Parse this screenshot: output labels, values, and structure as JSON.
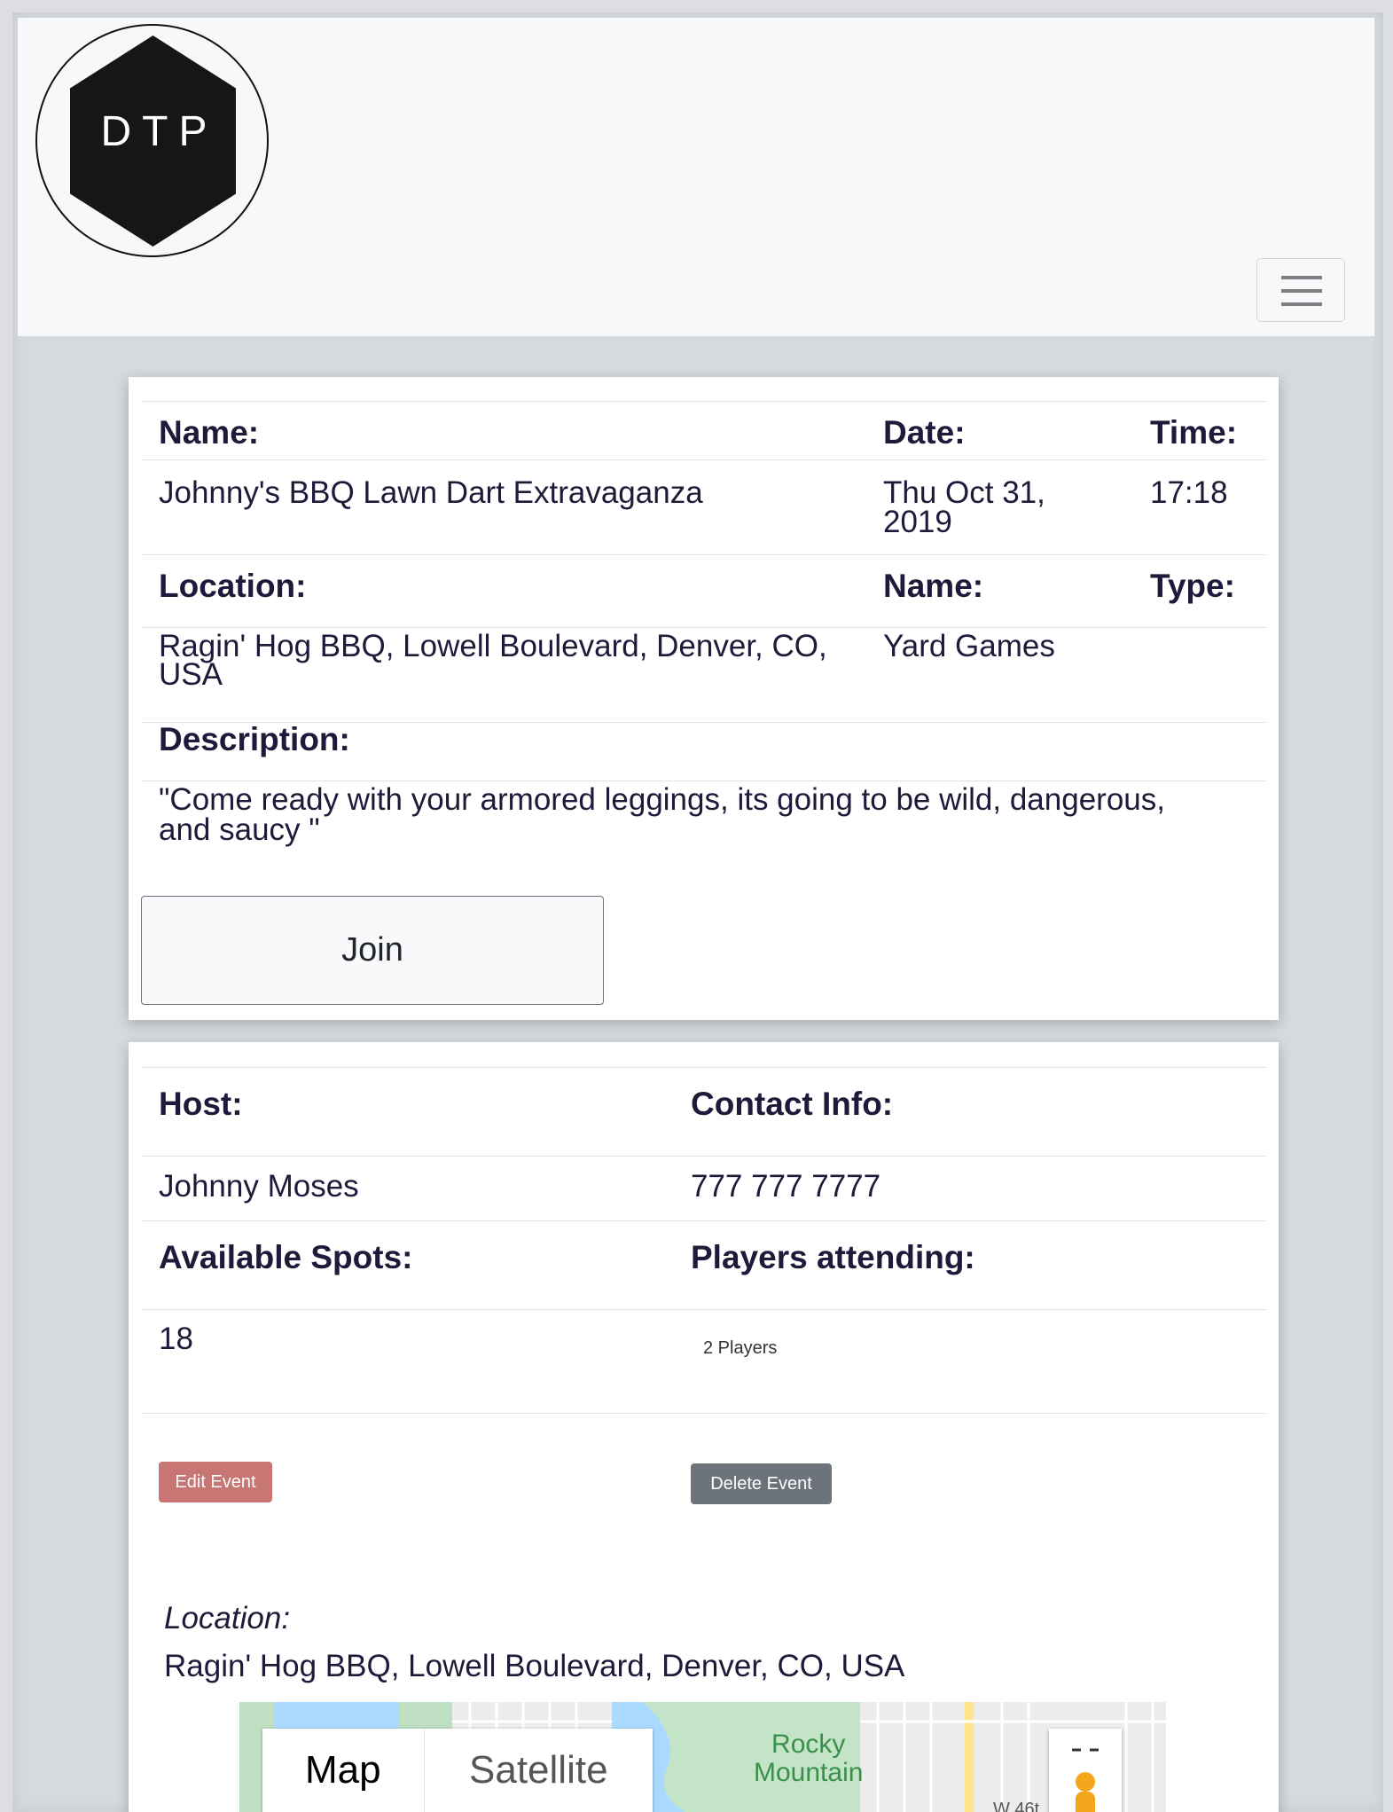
{
  "brand": {
    "logo_text": "DTP"
  },
  "nav": {
    "toggler_icon": "hamburger-icon"
  },
  "event": {
    "name_label": "Name:",
    "name_value": "Johnny's BBQ Lawn Dart Extravaganza",
    "date_label": "Date:",
    "date_value_line1": "Thu Oct 31,",
    "date_value_line2": "2019",
    "time_label": "Time:",
    "time_value": "17:18",
    "location_label": "Location:",
    "location_value_line1": "Ragin' Hog BBQ, Lowell Boulevard, Denver, CO,",
    "location_value_line2": "USA",
    "game_name_label": "Name:",
    "game_name_value": "Yard Games",
    "type_label": "Type:",
    "description_label": "Description:",
    "description_line1": "\"Come ready with your armored leggings, its going to be wild, dangerous,",
    "description_line2": "and saucy \"",
    "join_label": "Join"
  },
  "details": {
    "host_label": "Host:",
    "host_value": "Johnny Moses",
    "contact_label": "Contact Info:",
    "contact_value": "777 777 7777",
    "spots_label": "Available Spots:",
    "spots_value": "18",
    "attending_label": "Players attending:",
    "attending_value": "2 Players",
    "edit_label": "Edit Event",
    "delete_label": "Delete Event",
    "location_label": "Location:",
    "location_value": "Ragin' Hog BBQ, Lowell Boulevard, Denver, CO, USA"
  },
  "map": {
    "tab_map": "Map",
    "tab_satellite": "Satellite",
    "place_line1": "Rocky",
    "place_line2": "Mountain",
    "street": "W 46t"
  },
  "colors": {
    "edit_button": "#c77674",
    "delete_button": "#6c737b",
    "text": "#1f1a3a"
  }
}
